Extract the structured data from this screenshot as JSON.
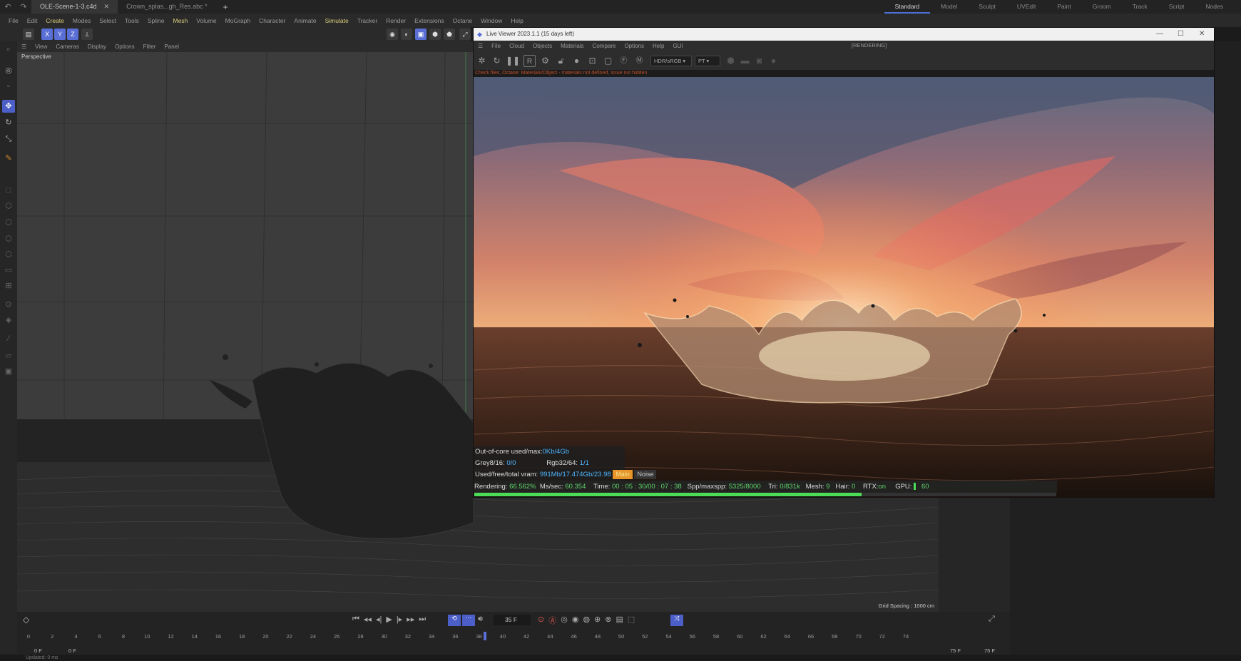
{
  "titlebar": {
    "tabs": [
      {
        "label": "OLE-Scene-1-3.c4d",
        "active": true
      },
      {
        "label": "Crown_splas...gh_Res.abc *",
        "active": false
      }
    ],
    "layouts": [
      "Standard",
      "Model",
      "Sculpt",
      "UVEdit",
      "Paint",
      "Groom",
      "Track",
      "Script",
      "Nodes"
    ],
    "active_layout": "Standard"
  },
  "menubar": [
    "File",
    "Edit",
    "Create",
    "Modes",
    "Select",
    "Tools",
    "Spline",
    "Mesh",
    "Volume",
    "MoGraph",
    "Character",
    "Animate",
    "Simulate",
    "Tracker",
    "Render",
    "Extensions",
    "Octane",
    "Window",
    "Help"
  ],
  "toolbar": {
    "axes": [
      "X",
      "Y",
      "Z"
    ]
  },
  "viewport": {
    "menu": [
      "View",
      "Cameras",
      "Display",
      "Options",
      "Filter",
      "Panel"
    ],
    "label": "Perspective",
    "grid_spacing": "Grid Spacing : 1000 cm"
  },
  "live_viewer": {
    "title": "Live Viewer 2023.1.1 (15 days left)",
    "menu": [
      "File",
      "Cloud",
      "Objects",
      "Materials",
      "Compare",
      "Options",
      "Help",
      "GUI"
    ],
    "status": "[RENDERING]",
    "mode_select": "HDR/sRGB",
    "kernel_select": "PT",
    "warning": "Check files, Octane: Materials/Object - materials not defined, issue not hidden",
    "hud": {
      "out_of_core_label": "Out-of-core used/max:",
      "out_of_core_value": "0Kb/4Gb",
      "grey_label": "Grey8/16:",
      "grey_value": "0/0",
      "rgb_label": "Rgb32/64:",
      "rgb_value": "1/1",
      "vram_label": "Used/free/total vram:",
      "vram_value": "991Mb/17.474Gb/23.98",
      "main_badge": "Main",
      "noise_badge": "Noise"
    },
    "render_status": {
      "rendering_label": "Rendering:",
      "rendering_value": "66.562%",
      "ms_label": "Ms/sec:",
      "ms_value": "60.354",
      "time_label": "Time:",
      "time_value": "00 : 05 : 30/00 : 07 : 38",
      "spp_label": "Spp/maxspp:",
      "spp_value": "5325/8000",
      "tri_label": "Tri:",
      "tri_value": "0/831k",
      "mesh_label": "Mesh:",
      "mesh_value": "9",
      "hair_label": "Hair:",
      "hair_value": "0",
      "rtx_label": "RTX:",
      "rtx_value": "on",
      "gpu_label": "GPU:",
      "gpu_value": "60"
    },
    "progress_fraction": 0.6656
  },
  "timeline": {
    "current_frame": "35 F",
    "start_frame": "0 F",
    "start_frame2": "0 F",
    "end_frame": "75 F",
    "end_frame2": "75 F",
    "ticks": [
      "0",
      "2",
      "4",
      "6",
      "8",
      "10",
      "12",
      "14",
      "16",
      "18",
      "20",
      "22",
      "24",
      "26",
      "28",
      "30",
      "32",
      "34",
      "36",
      "38",
      "40",
      "42",
      "44",
      "46",
      "48",
      "50",
      "52",
      "54",
      "56",
      "58",
      "60",
      "62",
      "64",
      "66",
      "68",
      "70",
      "72",
      "74"
    ]
  },
  "statusbar": {
    "text": "Updated: 0 ms"
  },
  "colors": {
    "accent": "#4c5ec8",
    "progress": "#4bdc58",
    "info": "#4fb6ff",
    "main_badge": "#e8962a"
  }
}
